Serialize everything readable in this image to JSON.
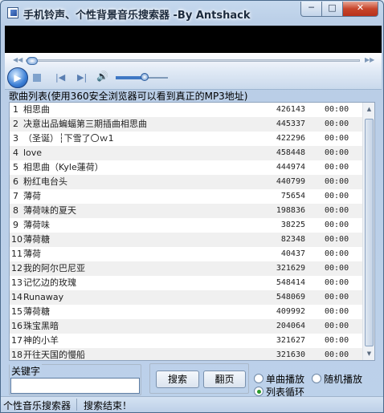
{
  "window": {
    "title": "手机铃声、个性背景音乐搜索器 -By Antshack",
    "min_glyph": "─",
    "max_glyph": "□",
    "close_glyph": "✕"
  },
  "player": {
    "play_glyph": "▶",
    "prev_glyph": "|◀",
    "next_glyph": "▶|",
    "volume_glyph": "🔊",
    "volume_level": 0.55,
    "seek_position": 0.0,
    "seek_left_glyph": "◀◀",
    "seek_right_glyph": "▶▶"
  },
  "list": {
    "label": "歌曲列表(使用360安全浏览器可以看到真正的MP3地址)",
    "rows": [
      {
        "idx": "1",
        "name": "相思曲",
        "size": "426143",
        "time": "00:00"
      },
      {
        "idx": "2",
        "name": "决意出品蝙蝠第三期插曲相思曲",
        "size": "445337",
        "time": "00:00"
      },
      {
        "idx": "3",
        "name": "（圣诞）┆下雪了〇ｗ1",
        "size": "422296",
        "time": "00:00"
      },
      {
        "idx": "4",
        "name": "love",
        "size": "458448",
        "time": "00:00"
      },
      {
        "idx": "5",
        "name": "相思曲（Kyle蓮荷）",
        "size": "444974",
        "time": "00:00"
      },
      {
        "idx": "6",
        "name": "粉红电台头",
        "size": "440799",
        "time": "00:00"
      },
      {
        "idx": "7",
        "name": "薄荷",
        "size": "75654",
        "time": "00:00"
      },
      {
        "idx": "8",
        "name": "薄荷味的夏天",
        "size": "198836",
        "time": "00:00"
      },
      {
        "idx": "9",
        "name": "薄荷味",
        "size": "38225",
        "time": "00:00"
      },
      {
        "idx": "10",
        "name": "薄荷糖",
        "size": "82348",
        "time": "00:00"
      },
      {
        "idx": "11",
        "name": "薄荷",
        "size": "40437",
        "time": "00:00"
      },
      {
        "idx": "12",
        "name": "我的阿尔巴尼亚",
        "size": "321629",
        "time": "00:00"
      },
      {
        "idx": "13",
        "name": "记忆边的玫瑰",
        "size": "548414",
        "time": "00:00"
      },
      {
        "idx": "14",
        "name": "Runaway",
        "size": "548069",
        "time": "00:00"
      },
      {
        "idx": "15",
        "name": "薄荷糖",
        "size": "409992",
        "time": "00:00"
      },
      {
        "idx": "16",
        "name": "珠宝黑暗",
        "size": "204064",
        "time": "00:00"
      },
      {
        "idx": "17",
        "name": "神的小羊",
        "size": "321627",
        "time": "00:00"
      },
      {
        "idx": "18",
        "name": "开往天国的慢船",
        "size": "321630",
        "time": "00:00"
      }
    ],
    "scroll_up_glyph": "▲",
    "scroll_down_glyph": "▼"
  },
  "search": {
    "keyword_label": "关键字",
    "keyword_value": "",
    "search_button": "搜索",
    "page_button": "翻页"
  },
  "play_mode": {
    "single": "单曲播放",
    "random": "随机播放",
    "loop": "列表循环",
    "selected": "loop"
  },
  "status": {
    "app_name": "个性音乐搜索器",
    "message": "搜索结束！"
  }
}
